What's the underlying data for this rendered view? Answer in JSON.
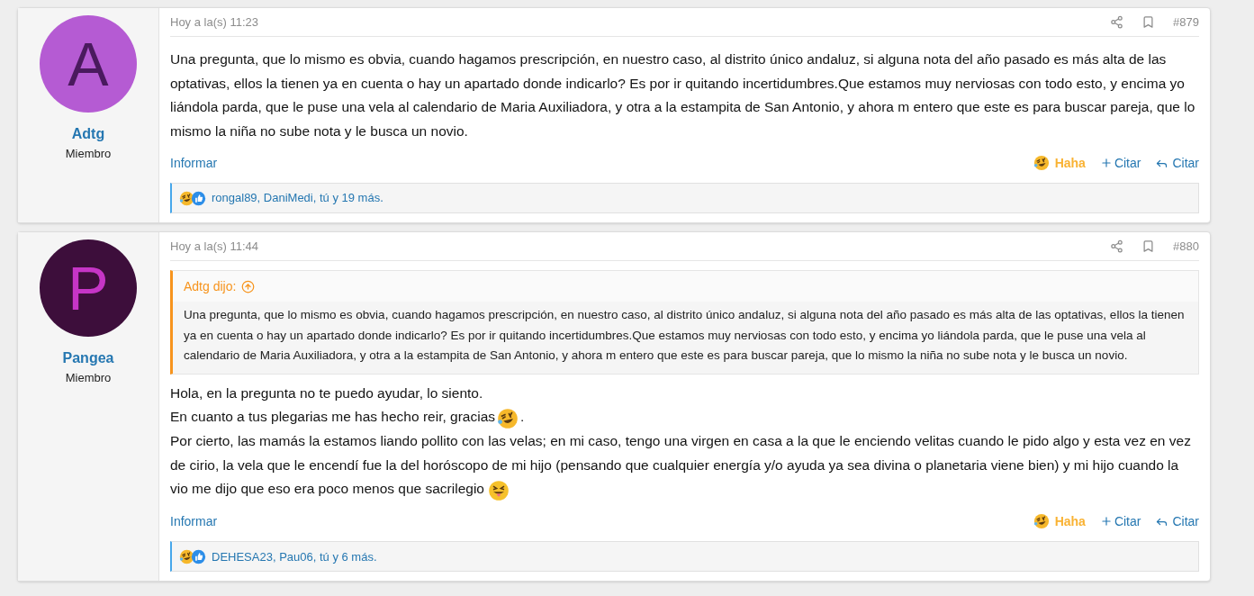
{
  "posts": [
    {
      "author": {
        "initial": {
          "text": "A",
          "color": "#4a1a5e"
        },
        "name": "Adtg",
        "role": "Miembro",
        "color": "#b55bd3"
      },
      "time": "Hoy a la(s) 11:23",
      "number": "#879",
      "paragraphs": [
        {
          "text": "Una pregunta, que lo mismo es obvia, cuando hagamos prescripción, en nuestro caso, al distrito único andaluz, si alguna nota del año pasado es más alta de las optativas, ellos la tienen ya en cuenta o hay un apartado donde indicarlo? Es por ir quitando incertidumbres.Que estamos muy nerviosas con todo esto, y encima yo liándola parda, que le puse una vela al calendario de Maria Auxiliadora, y otra a la estampita de San Antonio, y ahora m entero que este es para buscar pareja, que lo mismo la niña no sube nota y le busca un novio."
        }
      ],
      "report": "Informar",
      "reaction": {
        "label": "Haha",
        "selected": true
      },
      "multiquote": "Citar",
      "reply": "Citar",
      "reactions_summary": "rongal89, DaniMedi, tú y 19 más."
    },
    {
      "author": {
        "initial": {
          "text": "P",
          "color": "#c635c6"
        },
        "name": "Pangea",
        "role": "Miembro",
        "color": "#3d0e3b"
      },
      "time": "Hoy a la(s) 11:44",
      "number": "#880",
      "quote": {
        "title": "Adtg dijo:",
        "text": "Una pregunta, que lo mismo es obvia, cuando hagamos prescripción, en nuestro caso, al distrito único andaluz, si alguna nota del año pasado es más alta de las optativas, ellos la tienen ya en cuenta o hay un apartado donde indicarlo? Es por ir quitando incertidumbres.Que estamos muy nerviosas con todo esto, y encima yo liándola parda, que le puse una vela al calendario de Maria Auxiliadora, y otra a la estampita de San Antonio, y ahora m entero que este es para buscar pareja, que lo mismo la niña no sube nota y le busca un novio."
      },
      "paragraphs": [
        {
          "text": "Hola, en la pregunta no te puedo ayudar, lo siento."
        },
        {
          "text": "En cuanto a tus plegarias me has hecho reir, gracias",
          "kind": "rofl",
          "after": "."
        },
        {
          "text": "Por cierto, las mamás la estamos liando pollito con las velas; en mi caso, tengo una virgen en casa a la que le enciendo velitas cuando le pido algo y esta vez en vez de cirio, la vela que le encendí fue la del horóscopo de mi hijo (pensando que cualquier energía y/o ayuda ya sea divina o planetaria viene bien) y mi hijo cuando la vio me dijo que eso era poco menos que sacrilegio",
          "kind": "tongue"
        }
      ],
      "report": "Informar",
      "reaction": {
        "label": "Haha",
        "selected": true
      },
      "multiquote": "Citar",
      "reply": "Citar",
      "reactions_summary": "DEHESA23, Pau06, tú y 6 más."
    }
  ]
}
